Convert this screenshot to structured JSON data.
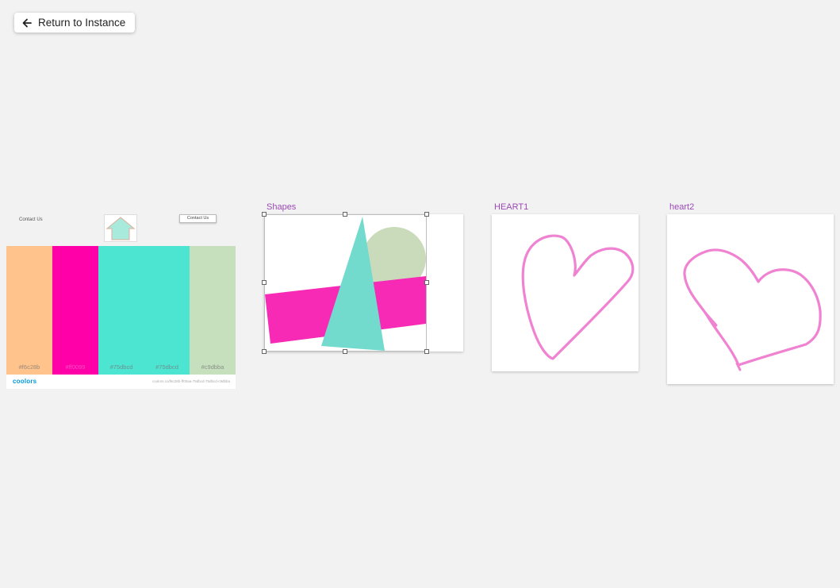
{
  "toolbar": {
    "return_label": "Return to Instance"
  },
  "palette_board": {
    "contact_text": "Contact Us",
    "contact_button": "Contact Us",
    "swatches": [
      {
        "code": "#f6c28b",
        "color": "#ffc38b"
      },
      {
        "code": "#ff0099",
        "color": "#ff00a8"
      },
      {
        "code": "#75dbcd",
        "color": "#4ce5d2"
      },
      {
        "code": "#75dbcd",
        "color": "#4ce5d2"
      },
      {
        "code": "#c9dbba",
        "color": "#c6e0bd"
      }
    ],
    "brand": "coolors",
    "url": "coolors.co/f6c28b-ff00aa-75dbcd-75dbcd-c9dbba"
  },
  "artboards": [
    {
      "name": "Shapes"
    },
    {
      "name": "HEART1"
    },
    {
      "name": "heart2"
    }
  ],
  "colors": {
    "label": "#9b4ab5",
    "heart_stroke": "#f082d2",
    "shape_circle": "#c9dbba",
    "shape_bar": "#f72ab6",
    "shape_triangle": "#72dbcd"
  }
}
